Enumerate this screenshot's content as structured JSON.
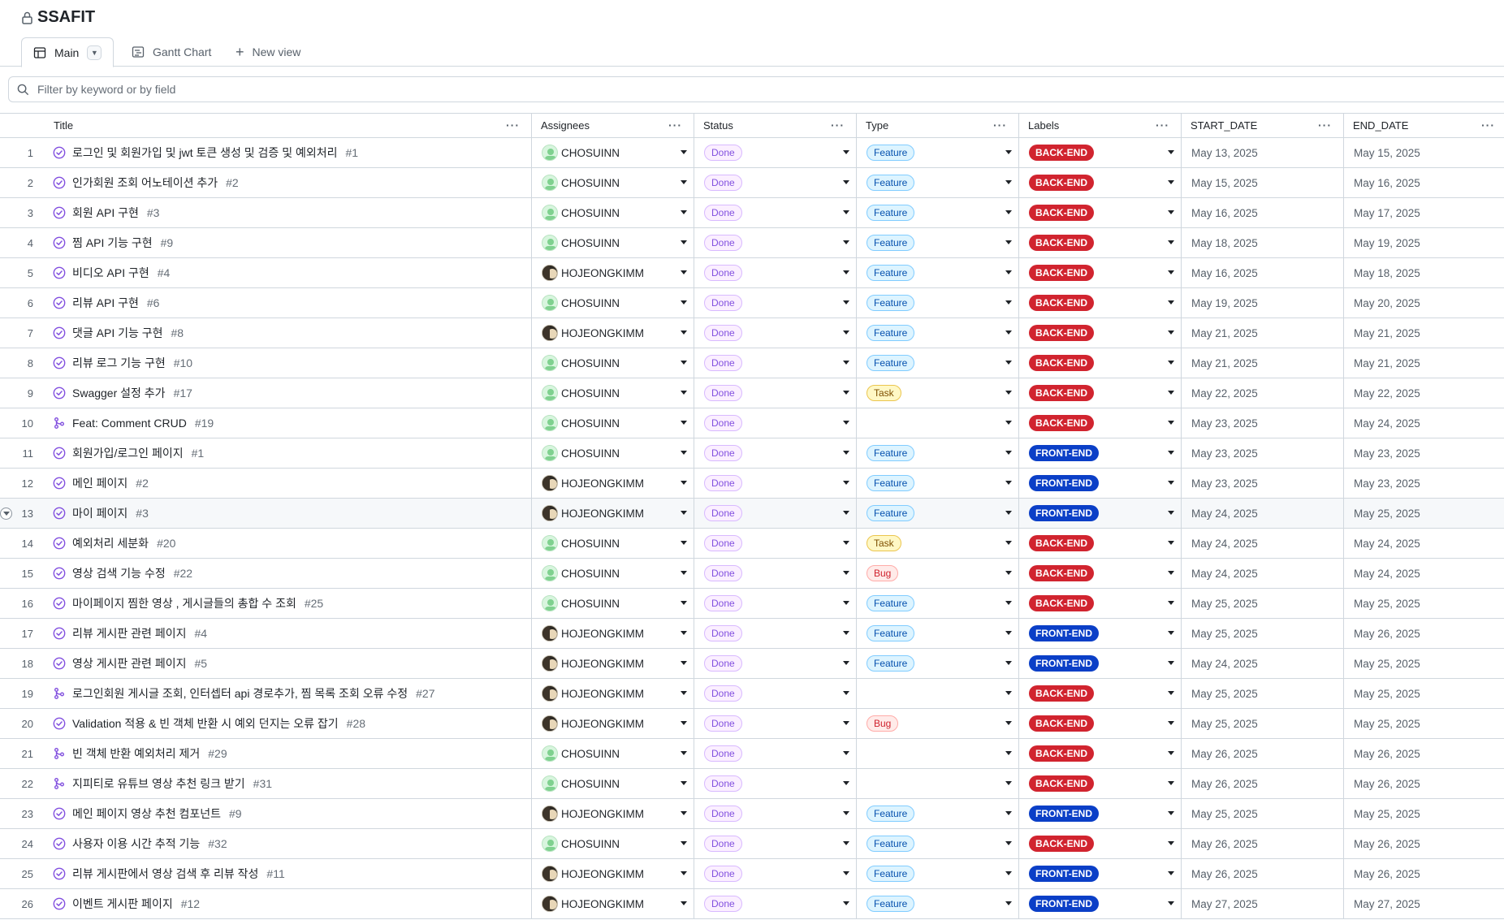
{
  "project": {
    "title": "SSAFIT"
  },
  "tabs": [
    {
      "label": "Main"
    },
    {
      "label": "Gantt Chart"
    },
    {
      "label": "New view"
    }
  ],
  "filter": {
    "placeholder": "Filter by keyword or by field"
  },
  "columns": {
    "title": "Title",
    "assignees": "Assignees",
    "status": "Status",
    "type": "Type",
    "labels": "Labels",
    "start": "START_DATE",
    "end": "END_DATE"
  },
  "colors": {
    "done": "#8250df",
    "feature": "#0550ae",
    "task": "#7d4e00",
    "bug": "#cf222e",
    "back_end": "#d1242f",
    "front_end": "#0b3fc7"
  },
  "rows": [
    {
      "n": "1",
      "icon": "issue-closed-icon",
      "title": "로그인 및 회원가입 및 jwt 토큰 생성 및 검증 및 예외처리",
      "num": "#1",
      "assignee": "CHOSUINN",
      "status": "Done",
      "type": "Feature",
      "label": "BACK-END",
      "start": "May 13, 2025",
      "end": "May 15, 2025"
    },
    {
      "n": "2",
      "icon": "issue-closed-icon",
      "title": "인가회원 조회 어노테이션 추가",
      "num": "#2",
      "assignee": "CHOSUINN",
      "status": "Done",
      "type": "Feature",
      "label": "BACK-END",
      "start": "May 15, 2025",
      "end": "May 16, 2025"
    },
    {
      "n": "3",
      "icon": "issue-closed-icon",
      "title": "회원 API 구현",
      "num": "#3",
      "assignee": "CHOSUINN",
      "status": "Done",
      "type": "Feature",
      "label": "BACK-END",
      "start": "May 16, 2025",
      "end": "May 17, 2025"
    },
    {
      "n": "4",
      "icon": "issue-closed-icon",
      "title": "찜 API 기능 구현",
      "num": "#9",
      "assignee": "CHOSUINN",
      "status": "Done",
      "type": "Feature",
      "label": "BACK-END",
      "start": "May 18, 2025",
      "end": "May 19, 2025"
    },
    {
      "n": "5",
      "icon": "issue-closed-icon",
      "title": "비디오 API 구현",
      "num": "#4",
      "assignee": "HOJEONGKIMM",
      "status": "Done",
      "type": "Feature",
      "label": "BACK-END",
      "start": "May 16, 2025",
      "end": "May 18, 2025"
    },
    {
      "n": "6",
      "icon": "issue-closed-icon",
      "title": "리뷰 API 구현",
      "num": "#6",
      "assignee": "CHOSUINN",
      "status": "Done",
      "type": "Feature",
      "label": "BACK-END",
      "start": "May 19, 2025",
      "end": "May 20, 2025"
    },
    {
      "n": "7",
      "icon": "issue-closed-icon",
      "title": "댓글 API 기능 구현",
      "num": "#8",
      "assignee": "HOJEONGKIMM",
      "status": "Done",
      "type": "Feature",
      "label": "BACK-END",
      "start": "May 21, 2025",
      "end": "May 21, 2025"
    },
    {
      "n": "8",
      "icon": "issue-closed-icon",
      "title": "리뷰 로그 기능 구현",
      "num": "#10",
      "assignee": "CHOSUINN",
      "status": "Done",
      "type": "Feature",
      "label": "BACK-END",
      "start": "May 21, 2025",
      "end": "May 21, 2025"
    },
    {
      "n": "9",
      "icon": "issue-closed-icon",
      "title": "Swagger 설정 추가",
      "num": "#17",
      "assignee": "CHOSUINN",
      "status": "Done",
      "type": "Task",
      "label": "BACK-END",
      "start": "May 22, 2025",
      "end": "May 22, 2025"
    },
    {
      "n": "10",
      "icon": "pull-request-merged-icon",
      "title": "Feat: Comment CRUD",
      "num": "#19",
      "assignee": "CHOSUINN",
      "status": "Done",
      "type": "",
      "label": "BACK-END",
      "start": "May 23, 2025",
      "end": "May 24, 2025"
    },
    {
      "n": "11",
      "icon": "issue-closed-icon",
      "title": "회원가입/로그인 페이지",
      "num": "#1",
      "assignee": "CHOSUINN",
      "status": "Done",
      "type": "Feature",
      "label": "FRONT-END",
      "start": "May 23, 2025",
      "end": "May 23, 2025"
    },
    {
      "n": "12",
      "icon": "issue-closed-icon",
      "title": "메인 페이지",
      "num": "#2",
      "assignee": "HOJEONGKIMM",
      "status": "Done",
      "type": "Feature",
      "label": "FRONT-END",
      "start": "May 23, 2025",
      "end": "May 23, 2025"
    },
    {
      "n": "13",
      "icon": "issue-closed-icon",
      "title": "마이 페이지",
      "num": "#3",
      "assignee": "HOJEONGKIMM",
      "status": "Done",
      "type": "Feature",
      "label": "FRONT-END",
      "start": "May 24, 2025",
      "end": "May 25, 2025",
      "highlight": true
    },
    {
      "n": "14",
      "icon": "issue-closed-icon",
      "title": "예외처리 세분화",
      "num": "#20",
      "assignee": "CHOSUINN",
      "status": "Done",
      "type": "Task",
      "label": "BACK-END",
      "start": "May 24, 2025",
      "end": "May 24, 2025"
    },
    {
      "n": "15",
      "icon": "issue-closed-icon",
      "title": "영상 검색 기능 수정",
      "num": "#22",
      "assignee": "CHOSUINN",
      "status": "Done",
      "type": "Bug",
      "label": "BACK-END",
      "start": "May 24, 2025",
      "end": "May 24, 2025"
    },
    {
      "n": "16",
      "icon": "issue-closed-icon",
      "title": "마이페이지 찜한 영상 , 게시글들의 총합 수 조회",
      "num": "#25",
      "assignee": "CHOSUINN",
      "status": "Done",
      "type": "Feature",
      "label": "BACK-END",
      "start": "May 25, 2025",
      "end": "May 25, 2025"
    },
    {
      "n": "17",
      "icon": "issue-closed-icon",
      "title": "리뷰 게시판 관련 페이지",
      "num": "#4",
      "assignee": "HOJEONGKIMM",
      "status": "Done",
      "type": "Feature",
      "label": "FRONT-END",
      "start": "May 25, 2025",
      "end": "May 26, 2025"
    },
    {
      "n": "18",
      "icon": "issue-closed-icon",
      "title": "영상 게시판 관련 페이지",
      "num": "#5",
      "assignee": "HOJEONGKIMM",
      "status": "Done",
      "type": "Feature",
      "label": "FRONT-END",
      "start": "May 24, 2025",
      "end": "May 25, 2025"
    },
    {
      "n": "19",
      "icon": "pull-request-merged-icon",
      "title": "로그인회원 게시글 조회, 인터셉터 api 경로추가, 찜 목록 조회 오류 수정",
      "num": "#27",
      "assignee": "HOJEONGKIMM",
      "status": "Done",
      "type": "",
      "label": "BACK-END",
      "start": "May 25, 2025",
      "end": "May 25, 2025"
    },
    {
      "n": "20",
      "icon": "issue-closed-icon",
      "title": "Validation 적용 & 빈 객체 반환 시 예외 던지는 오류 잡기",
      "num": "#28",
      "assignee": "HOJEONGKIMM",
      "status": "Done",
      "type": "Bug",
      "label": "BACK-END",
      "start": "May 25, 2025",
      "end": "May 25, 2025"
    },
    {
      "n": "21",
      "icon": "pull-request-merged-icon",
      "title": "빈 객체 반환 예외처리 제거",
      "num": "#29",
      "assignee": "CHOSUINN",
      "status": "Done",
      "type": "",
      "label": "BACK-END",
      "start": "May 26, 2025",
      "end": "May 26, 2025"
    },
    {
      "n": "22",
      "icon": "pull-request-merged-icon",
      "title": "지피티로 유튜브 영상 추천 링크 받기",
      "num": "#31",
      "assignee": "CHOSUINN",
      "status": "Done",
      "type": "",
      "label": "BACK-END",
      "start": "May 26, 2025",
      "end": "May 26, 2025"
    },
    {
      "n": "23",
      "icon": "issue-closed-icon",
      "title": "메인 페이지 영상 추천 컴포넌트",
      "num": "#9",
      "assignee": "HOJEONGKIMM",
      "status": "Done",
      "type": "Feature",
      "label": "FRONT-END",
      "start": "May 25, 2025",
      "end": "May 25, 2025"
    },
    {
      "n": "24",
      "icon": "issue-closed-icon",
      "title": "사용자 이용 시간 추적 기능",
      "num": "#32",
      "assignee": "CHOSUINN",
      "status": "Done",
      "type": "Feature",
      "label": "BACK-END",
      "start": "May 26, 2025",
      "end": "May 26, 2025"
    },
    {
      "n": "25",
      "icon": "issue-closed-icon",
      "title": "리뷰 게시판에서 영상 검색 후 리뷰 작성",
      "num": "#11",
      "assignee": "HOJEONGKIMM",
      "status": "Done",
      "type": "Feature",
      "label": "FRONT-END",
      "start": "May 26, 2025",
      "end": "May 26, 2025"
    },
    {
      "n": "26",
      "icon": "issue-closed-icon",
      "title": "이벤트 게시판 페이지",
      "num": "#12",
      "assignee": "HOJEONGKIMM",
      "status": "Done",
      "type": "Feature",
      "label": "FRONT-END",
      "start": "May 27, 2025",
      "end": "May 27, 2025"
    }
  ]
}
